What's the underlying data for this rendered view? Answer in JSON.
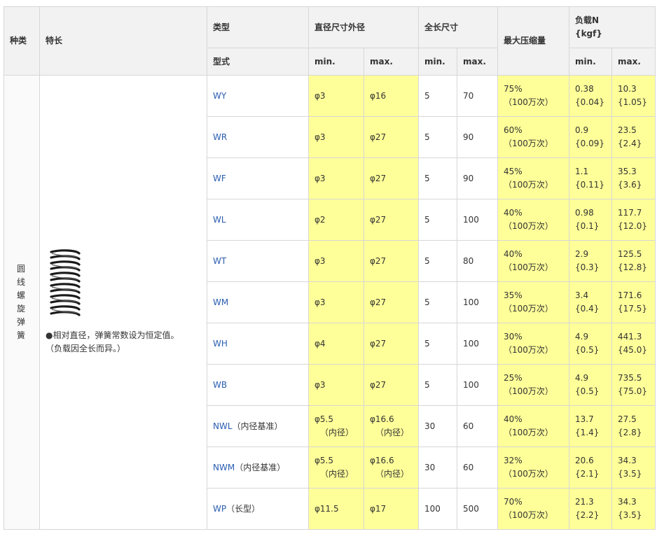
{
  "headers": {
    "kind": "种类",
    "feature": "特长",
    "type": "类型",
    "model": "型式",
    "outer_diameter": "直径尺寸外径",
    "total_length": "全长尺寸",
    "max_compression": "最大压缩量",
    "load": "负载N",
    "load_unit": "{kgf}",
    "min": "min.",
    "max": "max."
  },
  "kind": [
    "圆",
    "线",
    "螺",
    "旋",
    "弹",
    "簧"
  ],
  "feature": {
    "icon": "coil-spring-icon",
    "line1": "●相对直径，弹簧常数设为恒定值。",
    "line2": "（负载因全长而异。）"
  },
  "rows": [
    {
      "model": "WY",
      "note": "",
      "dmin": "φ3",
      "dmin2": "",
      "dmax": "φ16",
      "dmax2": "",
      "lmin": "5",
      "lmax": "70",
      "comp": "75%",
      "comp2": "（100万次）",
      "nmin": "0.38",
      "nmin2": "{0.04}",
      "nmax": "10.3",
      "nmax2": "{1.05}"
    },
    {
      "model": "WR",
      "note": "",
      "dmin": "φ3",
      "dmin2": "",
      "dmax": "φ27",
      "dmax2": "",
      "lmin": "5",
      "lmax": "90",
      "comp": "60%",
      "comp2": "（100万次）",
      "nmin": "0.9",
      "nmin2": "{0.09}",
      "nmax": "23.5",
      "nmax2": "{2.4}"
    },
    {
      "model": "WF",
      "note": "",
      "dmin": "φ3",
      "dmin2": "",
      "dmax": "φ27",
      "dmax2": "",
      "lmin": "5",
      "lmax": "90",
      "comp": "45%",
      "comp2": "（100万次）",
      "nmin": "1.1",
      "nmin2": "{0.11}",
      "nmax": "35.3",
      "nmax2": "{3.6}"
    },
    {
      "model": "WL",
      "note": "",
      "dmin": "φ2",
      "dmin2": "",
      "dmax": "φ27",
      "dmax2": "",
      "lmin": "5",
      "lmax": "100",
      "comp": "40%",
      "comp2": "（100万次）",
      "nmin": "0.98",
      "nmin2": "{0.1}",
      "nmax": "117.7",
      "nmax2": "{12.0}"
    },
    {
      "model": "WT",
      "note": "",
      "dmin": "φ3",
      "dmin2": "",
      "dmax": "φ27",
      "dmax2": "",
      "lmin": "5",
      "lmax": "80",
      "comp": "40%",
      "comp2": "（100万次）",
      "nmin": "2.9",
      "nmin2": "{0.3}",
      "nmax": "125.5",
      "nmax2": "{12.8}"
    },
    {
      "model": "WM",
      "note": "",
      "dmin": "φ3",
      "dmin2": "",
      "dmax": "φ27",
      "dmax2": "",
      "lmin": "5",
      "lmax": "100",
      "comp": "35%",
      "comp2": "（100万次）",
      "nmin": "3.4",
      "nmin2": "{0.4}",
      "nmax": "171.6",
      "nmax2": "{17.5}"
    },
    {
      "model": "WH",
      "note": "",
      "dmin": "φ4",
      "dmin2": "",
      "dmax": "φ27",
      "dmax2": "",
      "lmin": "5",
      "lmax": "100",
      "comp": "30%",
      "comp2": "（100万次）",
      "nmin": "4.9",
      "nmin2": "{0.5}",
      "nmax": "441.3",
      "nmax2": "{45.0}"
    },
    {
      "model": "WB",
      "note": "",
      "dmin": "φ3",
      "dmin2": "",
      "dmax": "φ27",
      "dmax2": "",
      "lmin": "5",
      "lmax": "100",
      "comp": "25%",
      "comp2": "（100万次）",
      "nmin": "4.9",
      "nmin2": "{0.5}",
      "nmax": "735.5",
      "nmax2": "{75.0}"
    },
    {
      "model": "NWL",
      "note": "（内径基准）",
      "dmin": "φ5.5",
      "dmin2": "（内径）",
      "dmax": "φ16.6",
      "dmax2": "（内径）",
      "lmin": "30",
      "lmax": "60",
      "comp": "40%",
      "comp2": "（100万次）",
      "nmin": "13.7",
      "nmin2": "{1.4}",
      "nmax": "27.5",
      "nmax2": "{2.8}"
    },
    {
      "model": "NWM",
      "note": "（内径基准）",
      "dmin": "φ5.5",
      "dmin2": "（内径）",
      "dmax": "φ16.6",
      "dmax2": "（内径）",
      "lmin": "30",
      "lmax": "60",
      "comp": "32%",
      "comp2": "（100万次）",
      "nmin": "20.6",
      "nmin2": "{2.1}",
      "nmax": "34.3",
      "nmax2": "{3.5}"
    },
    {
      "model": "WP",
      "note": "（长型）",
      "dmin": "φ11.5",
      "dmin2": "",
      "dmax": "φ17",
      "dmax2": "",
      "lmin": "100",
      "lmax": "500",
      "comp": "70%",
      "comp2": "（100万次）",
      "nmin": "21.3",
      "nmin2": "{2.2}",
      "nmax": "34.3",
      "nmax2": "{3.5}"
    }
  ]
}
